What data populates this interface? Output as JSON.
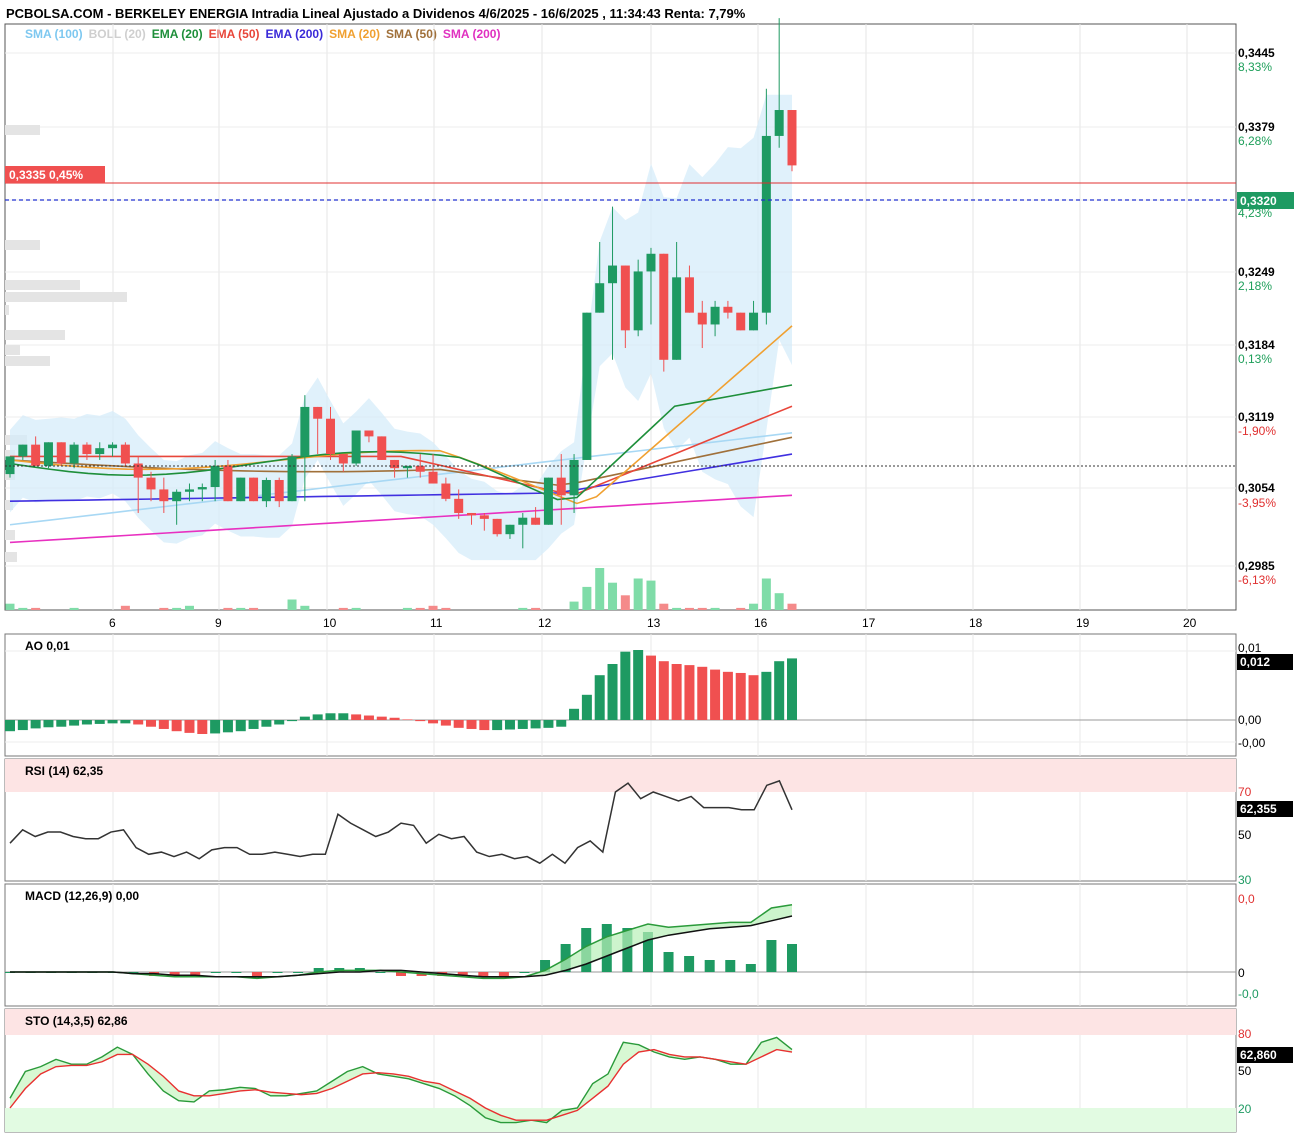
{
  "title": "PCBOLSA.COM - BERKELEY ENERGIA Intradia Lineal Ajustado a Dividenos 4/6/2025 - 16/6/2025 , 11:34:43 Renta: 7,79%",
  "legend": [
    {
      "label": "SMA (100)",
      "color": "#7ec8f0"
    },
    {
      "label": "BOLL (20)",
      "color": "#cfcfcf"
    },
    {
      "label": "EMA (20)",
      "color": "#1e8f3a"
    },
    {
      "label": "EMA (50)",
      "color": "#e8463a"
    },
    {
      "label": "EMA (200)",
      "color": "#3a2ad8"
    },
    {
      "label": "SMA (20)",
      "color": "#f0a030"
    },
    {
      "label": "SMA (50)",
      "color": "#a0703a"
    },
    {
      "label": "SMA (200)",
      "color": "#e030c0"
    }
  ],
  "price_axis": [
    {
      "price": "0,3445",
      "pct": "8,33%",
      "pctColor": "#1e9f5a"
    },
    {
      "price": "0,3379",
      "pct": "6,28%",
      "pctColor": "#1e9f5a"
    },
    {
      "price": "",
      "pct": "4,23%",
      "pctColor": "#1e9f5a"
    },
    {
      "price": "0,3249",
      "pct": "2,18%",
      "pctColor": "#1e9f5a"
    },
    {
      "price": "0,3184",
      "pct": "0,13%",
      "pctColor": "#1e9f5a"
    },
    {
      "price": "0,3119",
      "pct": "-1,90%",
      "pctColor": "#e03030"
    },
    {
      "price": "0,3054",
      "pct": "-3,95%",
      "pctColor": "#e03030"
    },
    {
      "price": "0,2985",
      "pct": "-6,13%",
      "pctColor": "#e03030"
    }
  ],
  "current_price_tag": "0,3320",
  "ref_price_tag": "0,3335  0,45%",
  "x_labels": [
    "6",
    "9",
    "10",
    "11",
    "12",
    "13",
    "16",
    "17",
    "18",
    "19",
    "20"
  ],
  "indicators": {
    "ao": {
      "label": "AO   0,01",
      "ticks": [
        "0,01",
        "0,00",
        "-0,00"
      ],
      "tag": "0,012"
    },
    "rsi": {
      "label": "RSI (14)   62,35",
      "ticks": [
        "70",
        "50",
        "30"
      ],
      "tag": "62,355"
    },
    "macd": {
      "label": "MACD (12,26,9)   0,00",
      "ticks": [
        "0,0",
        "0",
        "-0,0"
      ],
      "tag": ""
    },
    "sto": {
      "label": "STO (14,3,5)   62,86",
      "ticks": [
        "80",
        "50",
        "20"
      ],
      "tag": "62,860"
    }
  },
  "chart_data": {
    "type": "candlestick",
    "title": "PCBOLSA.COM - BERKELEY ENERGIA Intradia Lineal Ajustado a Dividenos 4/6/2025 - 16/6/2025 , 11:34:43 Renta: 7,79%",
    "ylim": [
      0.2985,
      0.3445
    ],
    "current_price": 0.332,
    "reference_price": 0.3335,
    "ohlc": [
      [
        0.3063,
        0.3078,
        0.306,
        0.3078
      ],
      [
        0.3078,
        0.3088,
        0.3075,
        0.3088
      ],
      [
        0.3088,
        0.3095,
        0.307,
        0.307
      ],
      [
        0.307,
        0.309,
        0.3068,
        0.309
      ],
      [
        0.309,
        0.309,
        0.307,
        0.3072
      ],
      [
        0.3072,
        0.309,
        0.3068,
        0.3088
      ],
      [
        0.3088,
        0.309,
        0.3075,
        0.308
      ],
      [
        0.308,
        0.309,
        0.3075,
        0.3085
      ],
      [
        0.3085,
        0.309,
        0.3078,
        0.3088
      ],
      [
        0.3088,
        0.309,
        0.307,
        0.3072
      ],
      [
        0.3072,
        0.3078,
        0.303,
        0.306
      ],
      [
        0.306,
        0.3065,
        0.304,
        0.305
      ],
      [
        0.305,
        0.306,
        0.303,
        0.304
      ],
      [
        0.304,
        0.305,
        0.302,
        0.3048
      ],
      [
        0.3048,
        0.3055,
        0.304,
        0.305
      ],
      [
        0.305,
        0.3055,
        0.304,
        0.3052
      ],
      [
        0.3052,
        0.3075,
        0.304,
        0.307
      ],
      [
        0.307,
        0.3075,
        0.304,
        0.304
      ],
      [
        0.304,
        0.306,
        0.304,
        0.306
      ],
      [
        0.306,
        0.306,
        0.304,
        0.304
      ],
      [
        0.304,
        0.306,
        0.3035,
        0.3058
      ],
      [
        0.3058,
        0.306,
        0.3035,
        0.304
      ],
      [
        0.304,
        0.308,
        0.304,
        0.3078
      ],
      [
        0.3078,
        0.313,
        0.304,
        0.312
      ],
      [
        0.312,
        0.312,
        0.308,
        0.311
      ],
      [
        0.311,
        0.312,
        0.3075,
        0.308
      ],
      [
        0.308,
        0.308,
        0.3065,
        0.3072
      ],
      [
        0.3072,
        0.31,
        0.307,
        0.31
      ],
      [
        0.31,
        0.31,
        0.309,
        0.3095
      ],
      [
        0.3095,
        0.3095,
        0.3075,
        0.3075
      ],
      [
        0.3075,
        0.3075,
        0.306,
        0.3068
      ],
      [
        0.3068,
        0.307,
        0.306,
        0.307
      ],
      [
        0.307,
        0.308,
        0.306,
        0.3065
      ],
      [
        0.3065,
        0.308,
        0.3055,
        0.3055
      ],
      [
        0.3055,
        0.306,
        0.304,
        0.3042
      ],
      [
        0.3042,
        0.305,
        0.3025,
        0.303
      ],
      [
        0.303,
        0.303,
        0.302,
        0.3028
      ],
      [
        0.3028,
        0.303,
        0.3015,
        0.3025
      ],
      [
        0.3025,
        0.3025,
        0.301,
        0.3012
      ],
      [
        0.3012,
        0.302,
        0.3008,
        0.302
      ],
      [
        0.302,
        0.303,
        0.3,
        0.3026
      ],
      [
        0.3026,
        0.3035,
        0.302,
        0.302
      ],
      [
        0.302,
        0.306,
        0.302,
        0.306
      ],
      [
        0.306,
        0.308,
        0.302,
        0.3045
      ],
      [
        0.3045,
        0.308,
        0.303,
        0.3075
      ],
      [
        0.3075,
        0.32,
        0.3075,
        0.32
      ],
      [
        0.32,
        0.326,
        0.32,
        0.3225
      ],
      [
        0.3225,
        0.329,
        0.316,
        0.324
      ],
      [
        0.324,
        0.324,
        0.317,
        0.3185
      ],
      [
        0.3185,
        0.3245,
        0.318,
        0.3235
      ],
      [
        0.3235,
        0.3255,
        0.319,
        0.325
      ],
      [
        0.325,
        0.325,
        0.315,
        0.316
      ],
      [
        0.316,
        0.326,
        0.316,
        0.323
      ],
      [
        0.323,
        0.324,
        0.32,
        0.32
      ],
      [
        0.32,
        0.321,
        0.317,
        0.319
      ],
      [
        0.319,
        0.321,
        0.318,
        0.3205
      ],
      [
        0.3205,
        0.321,
        0.3195,
        0.32
      ],
      [
        0.32,
        0.32,
        0.3185,
        0.3185
      ],
      [
        0.3185,
        0.321,
        0.3185,
        0.32
      ],
      [
        0.32,
        0.339,
        0.319,
        0.335
      ],
      [
        0.335,
        0.345,
        0.334,
        0.3372
      ],
      [
        0.3372,
        0.3372,
        0.332,
        0.3325
      ]
    ],
    "volume": [
      3,
      1,
      1,
      0,
      0,
      1,
      0,
      0,
      0,
      2,
      0,
      0,
      1,
      1,
      2,
      0,
      0,
      1,
      1,
      1,
      0,
      0,
      5,
      2,
      0,
      0,
      1,
      1,
      0,
      0,
      0,
      1,
      1,
      2,
      1,
      0,
      0,
      0,
      0,
      0,
      1,
      1,
      0,
      0,
      4,
      11,
      20,
      13,
      7,
      15,
      14,
      3,
      1,
      1,
      1,
      1,
      0,
      1,
      3,
      15,
      8,
      3
    ],
    "ao": [
      -0.002,
      -0.0018,
      -0.0015,
      -0.0013,
      -0.0012,
      -0.001,
      -0.0008,
      -0.0007,
      -0.0006,
      -0.0006,
      -0.0008,
      -0.0012,
      -0.0016,
      -0.002,
      -0.0023,
      -0.0025,
      -0.0024,
      -0.0022,
      -0.002,
      -0.0016,
      -0.0012,
      -0.0008,
      -0.0002,
      0.0006,
      0.001,
      0.0012,
      0.0012,
      0.001,
      0.0008,
      0.0006,
      0.0004,
      0.0001,
      -0.0002,
      -0.0006,
      -0.001,
      -0.0014,
      -0.0016,
      -0.0018,
      -0.0018,
      -0.0017,
      -0.0016,
      -0.0015,
      -0.0014,
      -0.0012,
      0.002,
      0.0045,
      0.008,
      0.01,
      0.0122,
      0.0125,
      0.0115,
      0.0105,
      0.01,
      0.0098,
      0.0095,
      0.009,
      0.0086,
      0.0084,
      0.008,
      0.0086,
      0.0105,
      0.011
    ],
    "rsi": [
      47,
      53,
      50,
      52,
      52,
      50,
      49,
      49,
      52,
      53,
      45,
      42,
      43,
      41,
      43,
      40,
      44,
      45,
      45,
      42,
      42,
      43,
      42,
      41,
      42,
      42,
      60,
      56,
      53,
      50,
      52,
      56,
      55,
      47,
      51,
      49,
      50,
      43,
      41,
      42,
      40,
      41,
      38,
      42,
      38,
      45,
      48,
      43,
      70,
      74,
      67,
      70,
      68,
      66,
      68,
      63,
      63,
      63,
      62,
      62,
      73,
      75,
      62
    ],
    "macd": {
      "macd": [
        0.0,
        0.0,
        0.0,
        0.0,
        0.0,
        0.0,
        -0.0001,
        -0.0002,
        -0.0003,
        -0.0003,
        -0.0003,
        -0.0003,
        -0.0004,
        -0.0003,
        -0.0002,
        0.0,
        0.0001,
        0.0001,
        0.0001,
        0.0,
        -0.0001,
        -0.0002,
        -0.0003,
        -0.0004,
        -0.0004,
        -0.0003,
        0.0001,
        0.0008,
        0.0016,
        0.0022,
        0.0026,
        0.003,
        0.0028,
        0.0029,
        0.003,
        0.0031,
        0.0031,
        0.004,
        0.0042
      ],
      "signal": [
        0.0,
        0.0,
        0.0,
        0.0,
        0.0,
        0.0,
        -0.0001,
        -0.0001,
        -0.0002,
        -0.0002,
        -0.0003,
        -0.0003,
        -0.0003,
        -0.0003,
        -0.0002,
        -0.0001,
        0.0,
        0.0,
        0.0001,
        0.0001,
        0.0,
        -0.0001,
        -0.0002,
        -0.0003,
        -0.0003,
        -0.0003,
        -0.0002,
        0.0001,
        0.0005,
        0.001,
        0.0015,
        0.002,
        0.0023,
        0.0025,
        0.0027,
        0.0028,
        0.0029,
        0.0032,
        0.0035
      ]
    },
    "sto": {
      "k": [
        28,
        50,
        54,
        60,
        56,
        56,
        62,
        70,
        64,
        48,
        34,
        26,
        25,
        34,
        35,
        37,
        36,
        30,
        30,
        32,
        34,
        42,
        50,
        54,
        48,
        46,
        44,
        40,
        36,
        30,
        22,
        12,
        8,
        8,
        10,
        8,
        18,
        20,
        40,
        48,
        74,
        72,
        66,
        62,
        60,
        62,
        60,
        56,
        56,
        74,
        78,
        68
      ],
      "d": [
        20,
        36,
        48,
        54,
        55,
        55,
        58,
        64,
        64,
        56,
        46,
        34,
        30,
        30,
        32,
        34,
        35,
        33,
        32,
        31,
        32,
        36,
        42,
        48,
        49,
        48,
        46,
        42,
        40,
        34,
        28,
        20,
        14,
        10,
        10,
        10,
        14,
        18,
        28,
        38,
        56,
        66,
        68,
        64,
        62,
        62,
        60,
        58,
        56,
        62,
        68,
        66
      ]
    }
  }
}
